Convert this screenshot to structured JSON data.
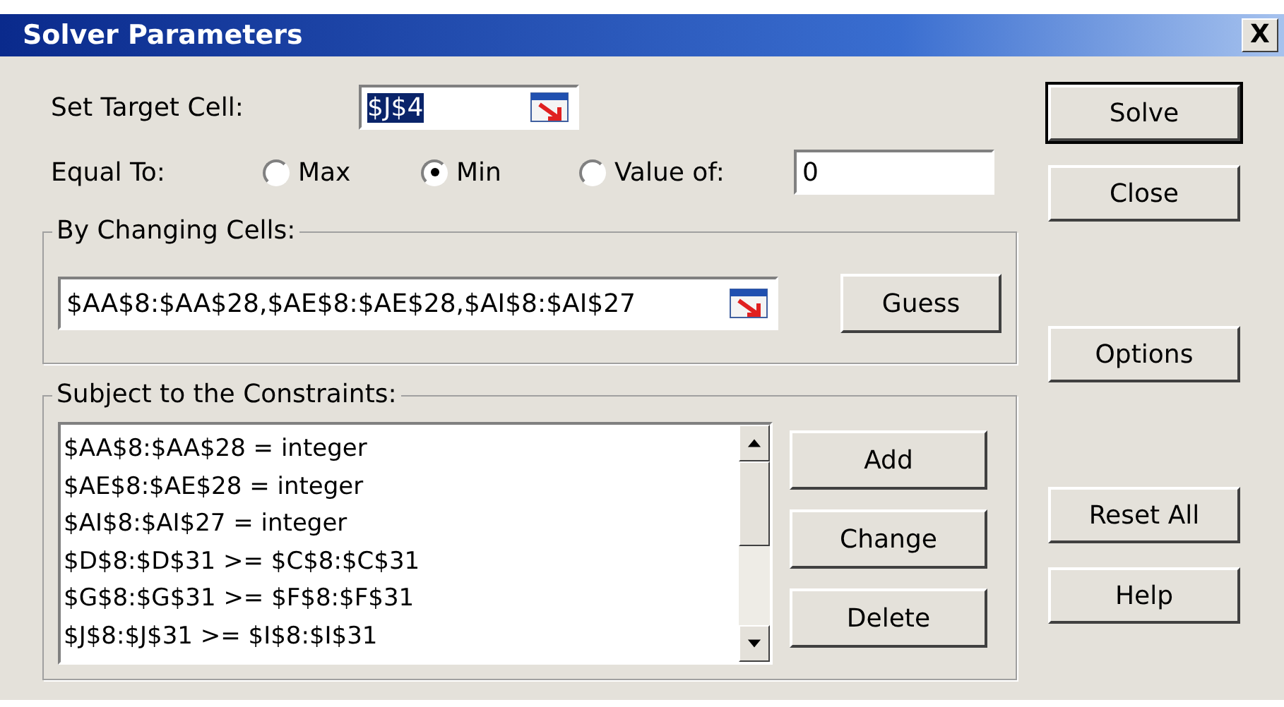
{
  "window": {
    "title": "Solver Parameters",
    "close": "X"
  },
  "target_cell": {
    "label": "Set Target Cell:",
    "value": "$J$4",
    "selected": true
  },
  "equal_to": {
    "label": "Equal To:",
    "options": [
      {
        "label": "Max",
        "selected": false
      },
      {
        "label": "Min",
        "selected": true
      },
      {
        "label": "Value of:",
        "selected": false
      }
    ],
    "value": "0"
  },
  "changing_cells": {
    "label": "By Changing Cells:",
    "value": "$AA$8:$AA$28,$AE$8:$AE$28,$AI$8:$AI$27",
    "button": "Guess"
  },
  "constraints": {
    "label": "Subject to the Constraints:",
    "items": [
      "$AA$8:$AA$28 = integer",
      "$AE$8:$AE$28 = integer",
      "$AI$8:$AI$27 = integer",
      "$D$8:$D$31 >= $C$8:$C$31",
      "$G$8:$G$31 >= $F$8:$F$31",
      "$J$8:$J$31 >= $I$8:$I$31"
    ],
    "buttons": [
      "Add",
      "Change",
      "Delete"
    ]
  },
  "side_buttons": [
    {
      "label": "Solve",
      "default": true
    },
    {
      "label": "Close",
      "default": false
    },
    {
      "label": "Options",
      "default": false
    },
    {
      "label": "Reset All",
      "default": false
    },
    {
      "label": "Help",
      "default": false
    }
  ]
}
